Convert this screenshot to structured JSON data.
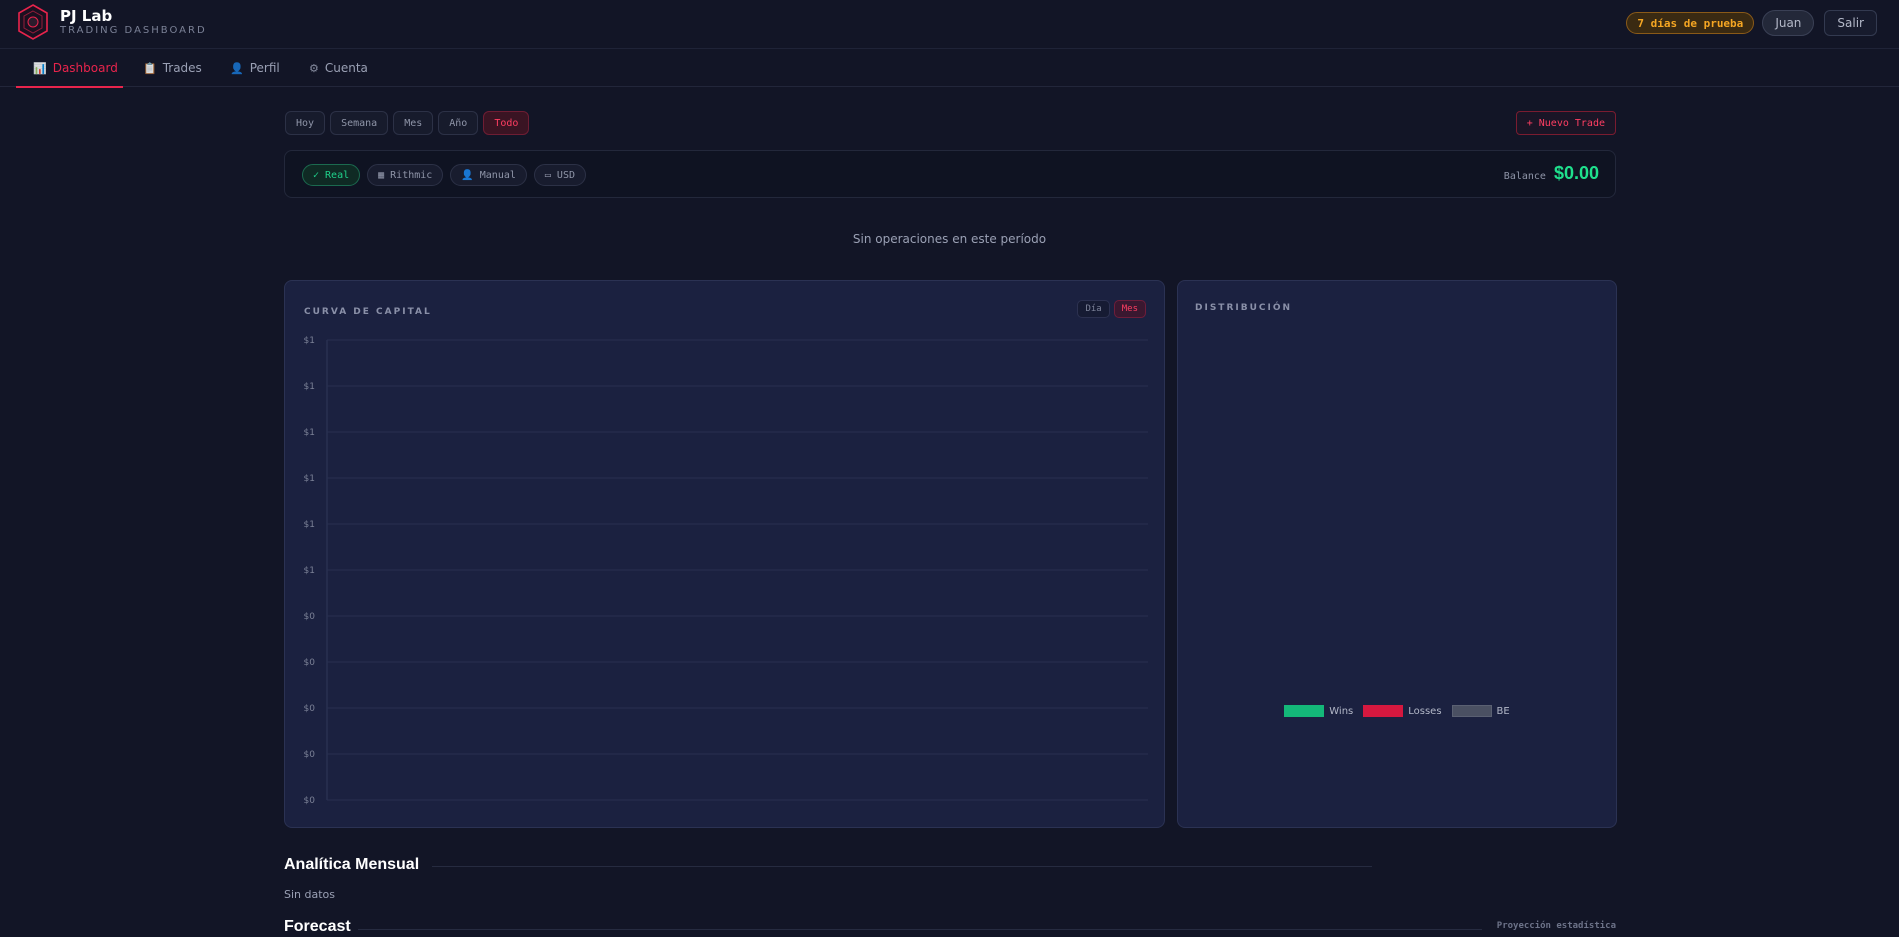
{
  "brand": {
    "name": "PJ Lab",
    "subtitle": "TRADING DASHBOARD"
  },
  "header": {
    "trial": "7 días de prueba",
    "user": "Juan",
    "logout": "Salir"
  },
  "nav": [
    {
      "icon": "bar-chart-icon",
      "glyph": "📊",
      "label": "Dashboard",
      "active": true
    },
    {
      "icon": "clipboard-icon",
      "glyph": "📋",
      "label": "Trades",
      "active": false
    },
    {
      "icon": "user-icon",
      "glyph": "👤",
      "label": "Perfil",
      "active": false
    },
    {
      "icon": "gear-icon",
      "glyph": "⚙",
      "label": "Cuenta",
      "active": false
    }
  ],
  "filters": [
    {
      "label": "Hoy",
      "active": false
    },
    {
      "label": "Semana",
      "active": false
    },
    {
      "label": "Mes",
      "active": false
    },
    {
      "label": "Año",
      "active": false
    },
    {
      "label": "Todo",
      "active": true
    }
  ],
  "new_trade": "+ Nuevo Trade",
  "account": {
    "pills": [
      {
        "icon": "check-icon",
        "glyph": "✓",
        "label": "Real",
        "style": "real"
      },
      {
        "icon": "server-icon",
        "glyph": "▦",
        "label": "Rithmic",
        "style": ""
      },
      {
        "icon": "user-icon",
        "glyph": "👤",
        "label": "Manual",
        "style": ""
      },
      {
        "icon": "card-icon",
        "glyph": "▭",
        "label": "USD",
        "style": ""
      }
    ],
    "balance_label": "Balance",
    "balance_value": "$0.00"
  },
  "empty_message": "Sin operaciones en este período",
  "capital_curve": {
    "title": "CURVA DE CAPITAL",
    "toggle": [
      {
        "label": "Día",
        "active": false
      },
      {
        "label": "Mes",
        "active": true
      }
    ]
  },
  "distribution": {
    "title": "DISTRIBUCIÓN",
    "legend": [
      {
        "label": "Wins",
        "color": "#14b879"
      },
      {
        "label": "Losses",
        "color": "#d6183f"
      },
      {
        "label": "BE",
        "color": "#4a5062"
      }
    ]
  },
  "monthly": {
    "title": "Analítica Mensual",
    "empty": "Sin datos"
  },
  "forecast": {
    "title": "Forecast",
    "note": "Proyección estadística"
  },
  "colors": {
    "accent": "#e8244c",
    "positive": "#1fe08d",
    "panel": "#1b2140",
    "background": "#121526"
  },
  "chart_data": {
    "type": "line",
    "title": "CURVA DE CAPITAL",
    "x": [],
    "series": [],
    "y_ticks": [
      "$1",
      "$1",
      "$1",
      "$1",
      "$1",
      "$1",
      "$0",
      "$0",
      "$0",
      "$0",
      "$0"
    ],
    "grid": true
  }
}
